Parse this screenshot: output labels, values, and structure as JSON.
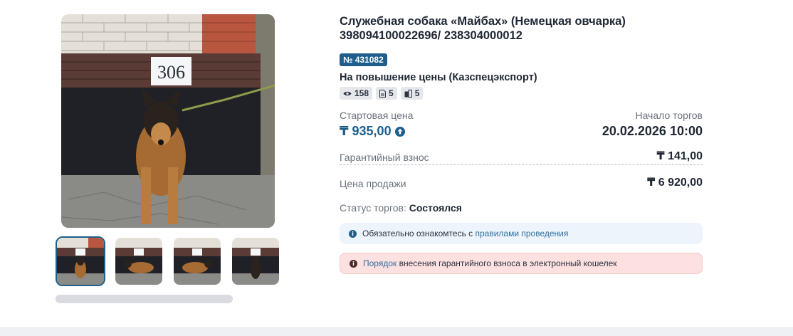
{
  "gallery": {
    "house_number": "306",
    "thumbnail_count": 4,
    "active_thumbnail": 0
  },
  "lot": {
    "title": "Служебная собака «Майбах» (Немецкая овчарка) 398094100022696/ 238304000012",
    "number": "№ 431082",
    "auction_type": "На повышение цены (Казспецэкспорт)",
    "stats": {
      "views": "158",
      "documents": "5",
      "bids": "5"
    }
  },
  "prices": {
    "start_label": "Стартовая цена",
    "start_value": "₸ 935,00",
    "trade_start_label": "Начало торгов",
    "trade_start_value": "20.02.2026 10:00",
    "guarantee_label": "Гарантийный взнос",
    "guarantee_value": "₸ 141,00",
    "sale_label": "Цена продажи",
    "sale_value": "₸ 6 920,00"
  },
  "status": {
    "label": "Статус торгов:",
    "value": "Состоялся"
  },
  "notices": {
    "rules_text": "Обязательно ознакомтесь с",
    "rules_link": "правилами проведения",
    "deposit_link": "Порядок",
    "deposit_text": "внесения гарантийного взноса в электронный кошелек"
  },
  "colors": {
    "accent": "#1d5e8c",
    "alert_bg": "#fde0e0",
    "info_bg": "#eef4fb"
  },
  "icons": {
    "views": "eye-icon",
    "documents": "document-icon",
    "bids": "bids-icon",
    "price_up": "arrow-up-circle-icon",
    "info": "info-icon"
  }
}
